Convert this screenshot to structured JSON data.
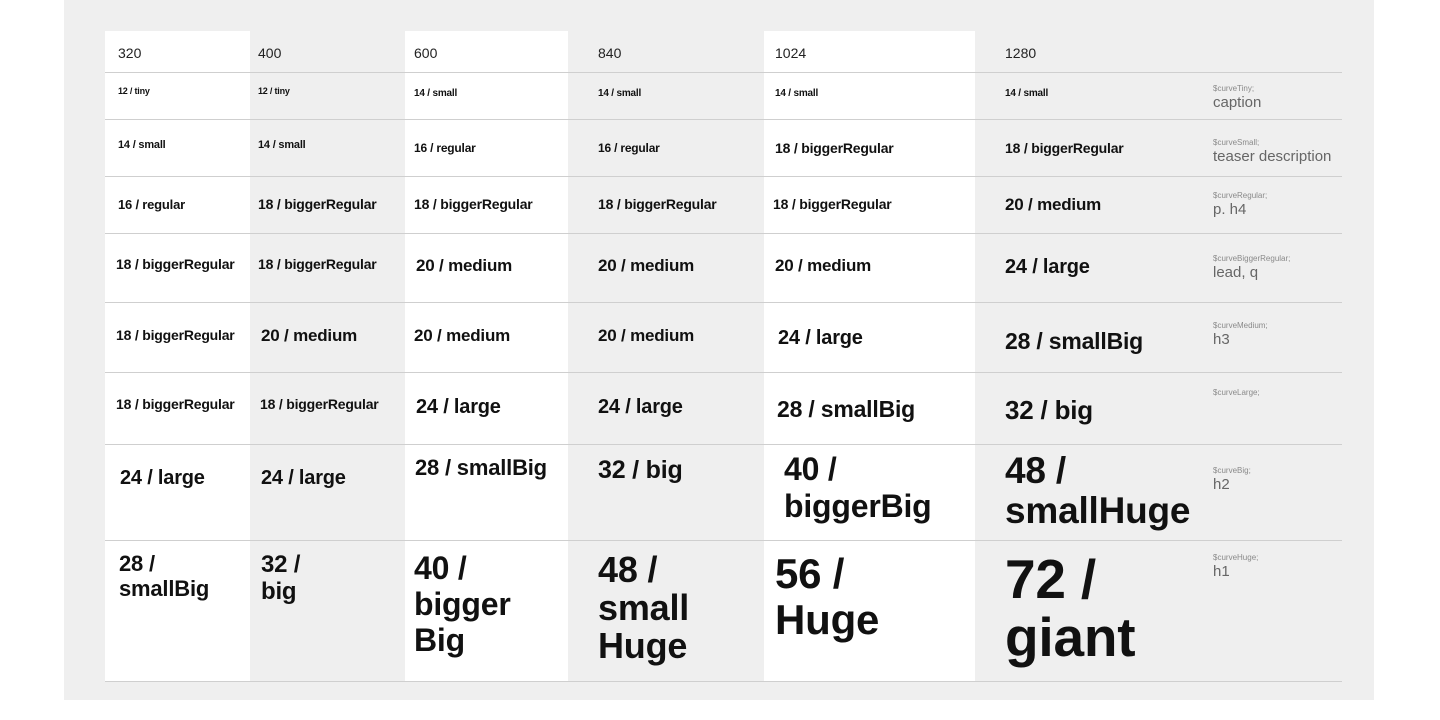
{
  "headers": [
    "320",
    "400",
    "600",
    "840",
    "1024",
    "1280"
  ],
  "rows": [
    {
      "cells": [
        "12 / tiny",
        "12 / tiny",
        "14 / small",
        "14 / small",
        "14 / small",
        "14 / small"
      ],
      "usage_var": "$curveTiny;",
      "usage_desc": "caption"
    },
    {
      "cells": [
        "14 / small",
        "14 / small",
        "16 / regular",
        "16 / regular",
        "18 / biggerRegular",
        "18 / biggerRegular"
      ],
      "usage_var": "$curveSmall;",
      "usage_desc": "teaser description"
    },
    {
      "cells": [
        "16 / regular",
        "18 / biggerRegular",
        "18 / biggerRegular",
        "18 / biggerRegular",
        "18 / biggerRegular",
        "20 / medium"
      ],
      "usage_var": "$curveRegular;",
      "usage_desc": "p. h4"
    },
    {
      "cells": [
        "18 / biggerRegular",
        "18 / biggerRegular",
        "20 / medium",
        "20 / medium",
        "20 / medium",
        "24 / large"
      ],
      "usage_var": "$curveBiggerRegular;",
      "usage_desc": "lead, q"
    },
    {
      "cells": [
        "18 / biggerRegular",
        "20 / medium",
        "20 / medium",
        "20 / medium",
        "24 / large",
        "28 / smallBig"
      ],
      "usage_var": "$curveMedium;",
      "usage_desc": "h3"
    },
    {
      "cells": [
        "18 / biggerRegular",
        "18 / biggerRegular",
        "24 / large",
        "24 / large",
        "28 / smallBig",
        "32 / big"
      ],
      "usage_var": "$curveLarge;",
      "usage_desc": ""
    },
    {
      "cells": [
        "24 / large",
        "24 / large",
        "28 / smallBig",
        "32 / big",
        "40 / biggerBig",
        "48 / smallHuge"
      ],
      "usage_var": "$curveBig;",
      "usage_desc": "h2"
    },
    {
      "cells": [
        "28 / smallBig",
        "32 / big",
        "40 / bigger Big",
        "48 / small Huge",
        "56 / Huge",
        "72 / giant"
      ],
      "usage_var": "$curveHuge;",
      "usage_desc": "h1"
    }
  ]
}
